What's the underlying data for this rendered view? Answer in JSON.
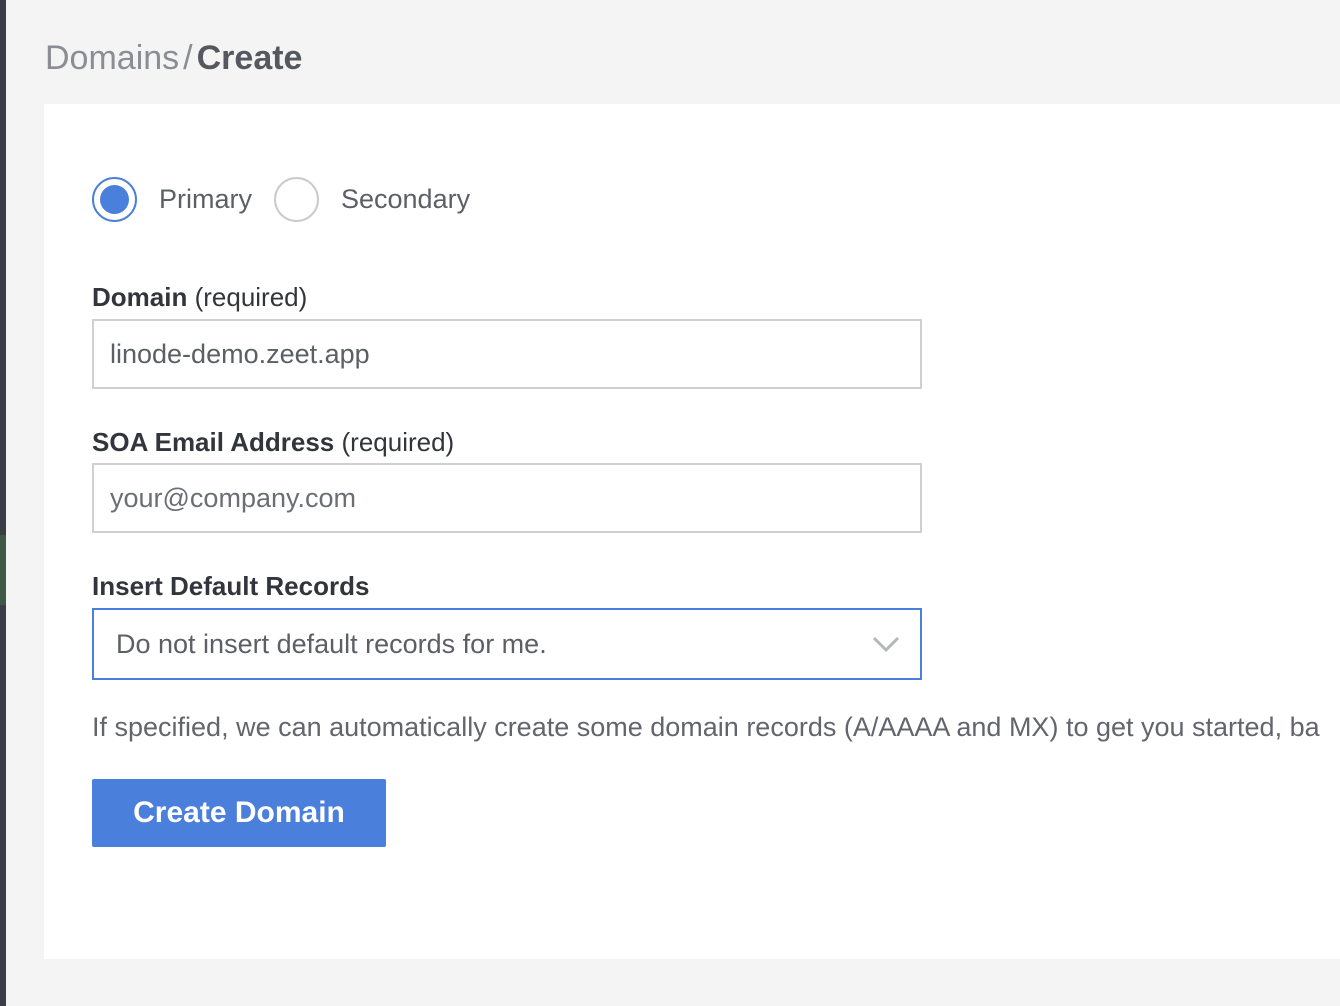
{
  "breadcrumb": {
    "parent": "Domains",
    "separator": "/",
    "current": "Create"
  },
  "form": {
    "type_radio": {
      "options": [
        {
          "label": "Primary",
          "checked": true
        },
        {
          "label": "Secondary",
          "checked": false
        }
      ]
    },
    "domain": {
      "label": "Domain",
      "required_text": "(required)",
      "value": "linode-demo.zeet.app"
    },
    "soa_email": {
      "label": "SOA Email Address",
      "required_text": "(required)",
      "placeholder": "your@company.com",
      "value": ""
    },
    "default_records": {
      "label": "Insert Default Records",
      "selected": "Do not insert default records for me."
    },
    "helper_text": "If specified, we can automatically create some domain records (A/AAAA and MX) to get you started, ba",
    "submit_label": "Create Domain"
  },
  "colors": {
    "accent": "#4a7fdb",
    "background": "#f4f4f5",
    "panel": "#ffffff"
  },
  "icons": {
    "select_chevron": "chevron-down-icon"
  }
}
